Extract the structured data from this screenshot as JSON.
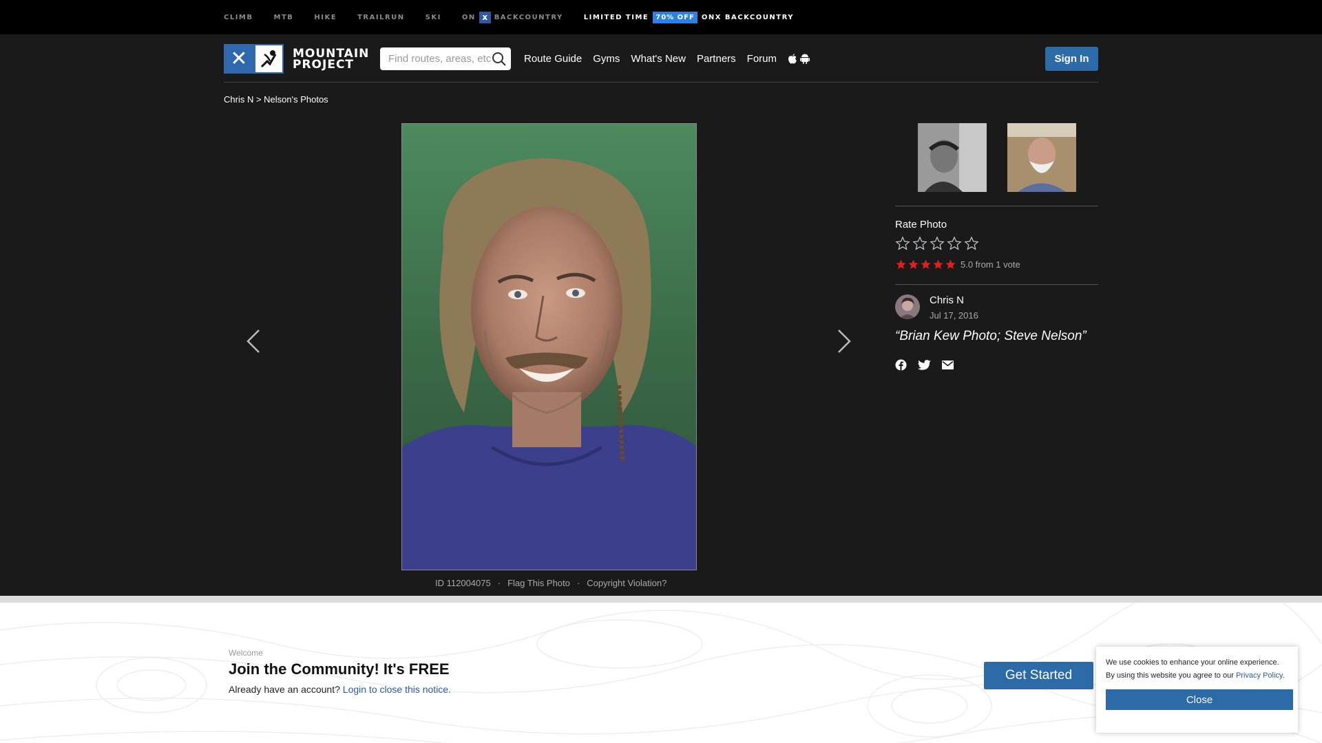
{
  "topbar": {
    "links": [
      "CLIMB",
      "MTB",
      "HIKE",
      "TRAILRUN",
      "SKI"
    ],
    "on_label": "ON",
    "onx_icon": "x",
    "backcountry": "BACKCOUNTRY",
    "promo_prefix": "LIMITED TIME",
    "promo_badge": "70% OFF",
    "promo_suffix": "ONX BACKCOUNTRY"
  },
  "header": {
    "logo_line1": "MOUNTAIN",
    "logo_line2": "PROJECT",
    "search_placeholder": "Find routes, areas, etc",
    "nav": [
      "Route Guide",
      "Gyms",
      "What's New",
      "Partners",
      "Forum"
    ],
    "sign_in": "Sign In"
  },
  "breadcrumb": "Chris N > Nelson's Photos",
  "photo_meta": {
    "id": "ID 112004075",
    "sep": "·",
    "flag": "Flag This Photo",
    "copyright": "Copyright Violation?"
  },
  "sidebar": {
    "rate_label": "Rate Photo",
    "rating_text": "5.0 from 1 vote",
    "rating_value": 5,
    "author_name": "Chris N",
    "author_date": "Jul 17, 2016",
    "caption": "“Brian Kew Photo; Steve Nelson”"
  },
  "join": {
    "welcome": "Welcome",
    "title": "Join the Community! It's FREE",
    "account_text": "Already have an account?",
    "login_link": "Login to close this notice.",
    "get_started": "Get Started"
  },
  "cookie": {
    "text": "We use cookies to enhance your online experience. By using this website you agree to our",
    "link": "Privacy Policy",
    "close": "Close"
  },
  "colors": {
    "brand_blue": "#2c6aa8",
    "star_red": "#e02020",
    "promo_blue": "#2a82e4"
  }
}
